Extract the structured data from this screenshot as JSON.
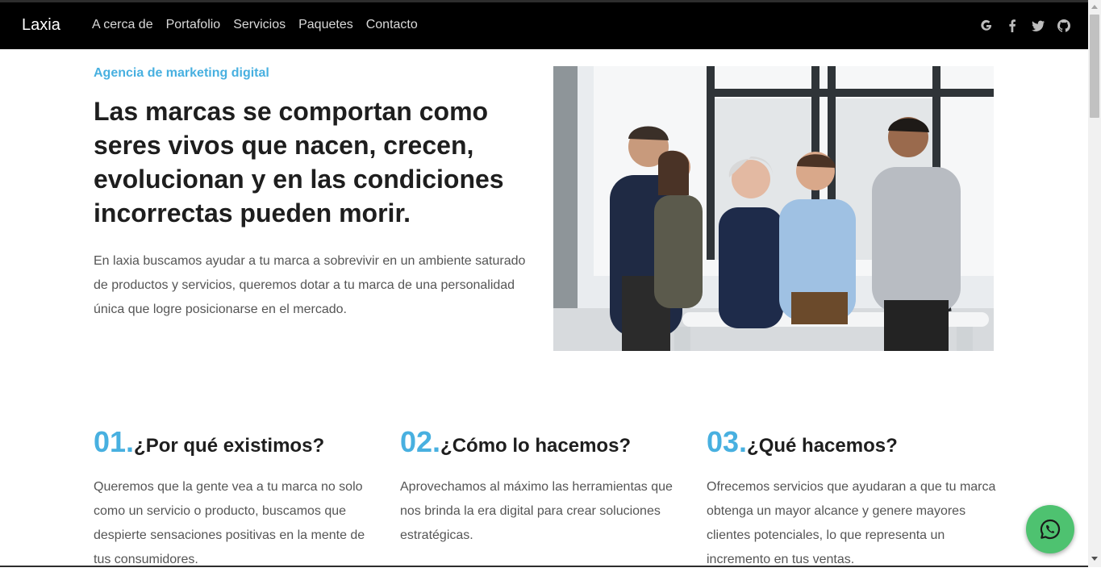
{
  "navbar": {
    "brand": "Laxia",
    "links": [
      "A cerca de",
      "Portafolio",
      "Servicios",
      "Paquetes",
      "Contacto"
    ],
    "social_icons": [
      "google-icon",
      "facebook-icon",
      "twitter-icon",
      "github-icon"
    ]
  },
  "hero": {
    "eyebrow": "Agencia de marketing digital",
    "headline": "Las marcas se comportan como seres vivos que nacen, crecen, evolucionan y en las condiciones incorrectas pueden morir.",
    "description": "En laxia buscamos ayudar a tu marca a sobrevivir en un ambiente saturado de productos y servicios, queremos dotar a tu marca de una personalidad única que logre posicionarse en el mercado.",
    "image_subject": "team-meeting-photo"
  },
  "features": [
    {
      "number": "01.",
      "title": "¿Por qué existimos?",
      "text": "Queremos que la gente vea a tu marca no solo como un servicio o producto, buscamos que despierte sensaciones positivas en la mente de tus consumidores."
    },
    {
      "number": "02.",
      "title": "¿Cómo lo hacemos?",
      "text": "Aprovechamos al máximo las herramientas que nos brinda la era digital para crear soluciones estratégicas."
    },
    {
      "number": "03.",
      "title": "¿Qué hacemos?",
      "text": "Ofrecemos servicios que ayudaran a que tu marca obtenga un mayor alcance y genere mayores clientes potenciales, lo que representa un incremento en tus ventas."
    }
  ],
  "floating_button": {
    "icon": "whatsapp-icon"
  },
  "colors": {
    "accent": "#48b0e0",
    "navbar_bg": "#000000",
    "heading": "#1e1e1e",
    "body_text": "#555555",
    "whatsapp": "#4ec270"
  }
}
